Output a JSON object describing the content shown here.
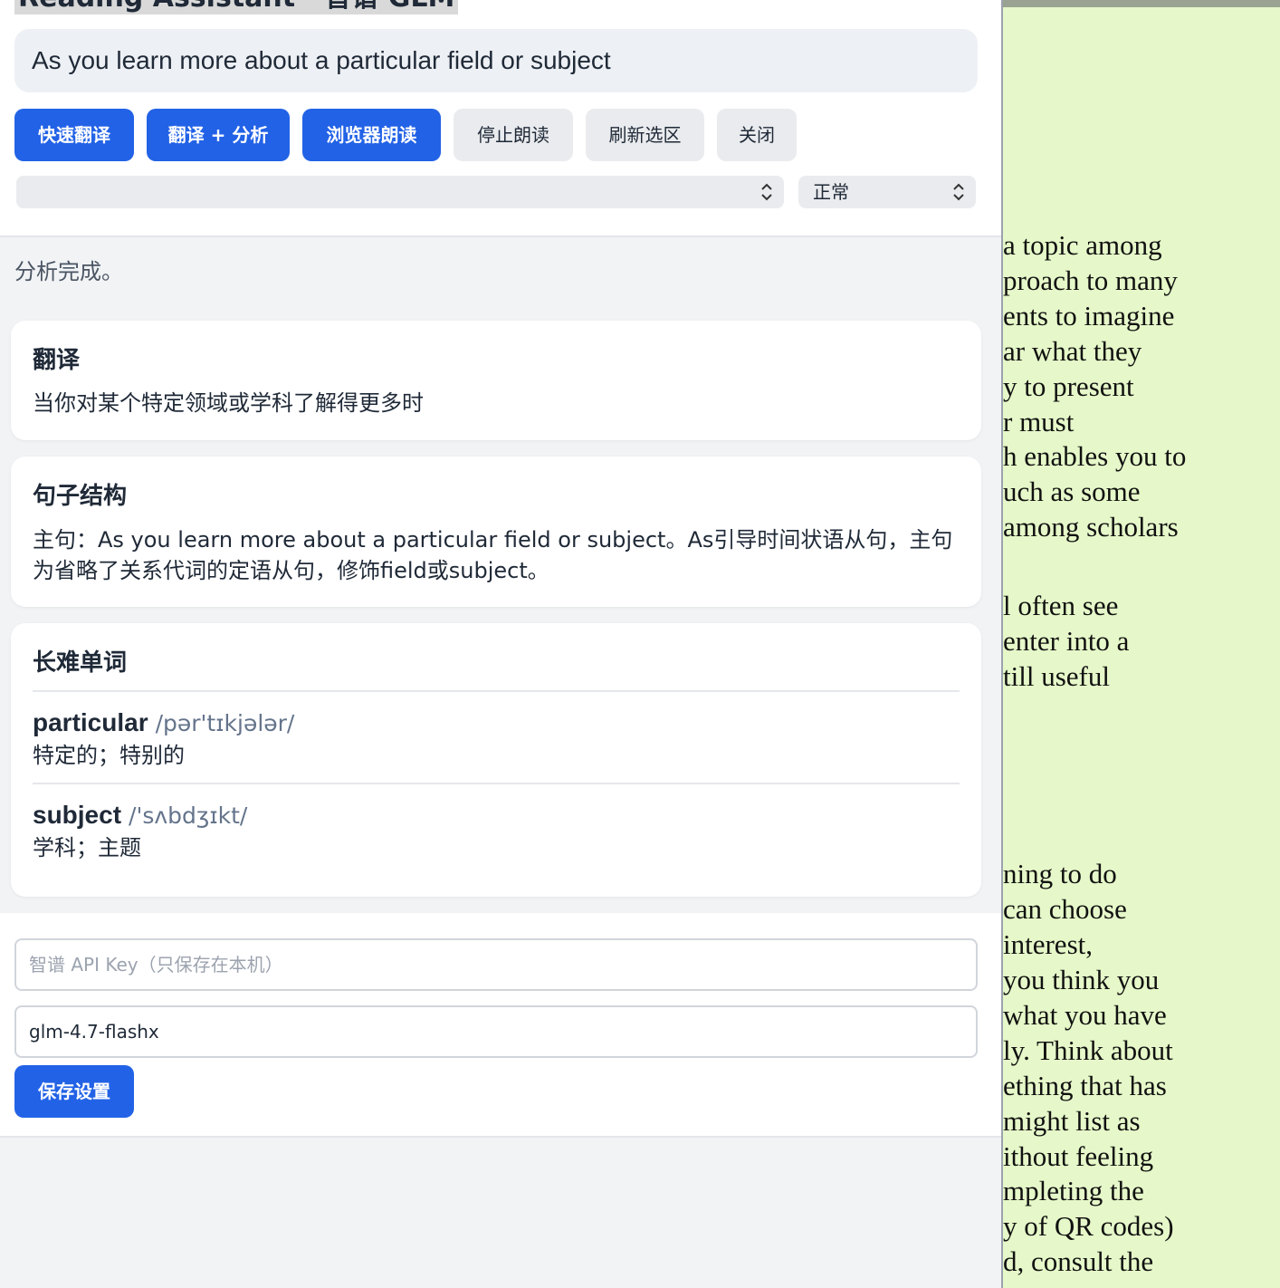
{
  "panel": {
    "title": "Reading Assistant · 智谱 GLM",
    "selection_text": "As you learn more about a particular field or subject",
    "buttons": {
      "quick_translate": "快速翻译",
      "translate_analyze": "翻译 + 分析",
      "browser_read": "浏览器朗读",
      "stop_read": "停止朗读",
      "refresh_selection": "刷新选区",
      "close": "关闭"
    },
    "voice_select_value": "",
    "speed_select_value": "正常",
    "status": "分析完成。",
    "translation": {
      "title": "翻译",
      "text": "当你对某个特定领域或学科了解得更多时"
    },
    "structure": {
      "title": "句子结构",
      "text": "主句：As you learn more about a particular field or subject。As引导时间状语从句，主句为省略了关系代词的定语从句，修饰field或subject。"
    },
    "vocabulary": {
      "title": "长难单词",
      "words": [
        {
          "word": "particular",
          "phonetic": "/pər'tɪkjələr/",
          "meaning": "特定的；特别的"
        },
        {
          "word": "subject",
          "phonetic": "/'sʌbdʒɪkt/",
          "meaning": "学科；主题"
        }
      ]
    },
    "settings": {
      "api_key_placeholder": "智谱 API Key（只保存在本机）",
      "api_key_value": "",
      "model_value": "glm-4.7-flashx",
      "save_label": "保存设置"
    }
  },
  "page_lines": [
    "a topic among",
    "proach to many",
    "ents to imagine",
    "ar what they",
    "y to present",
    "r must",
    "h enables you to",
    "uch as some",
    "among scholars",
    "l often see",
    "enter into a",
    "till useful",
    "ning to do",
    "can choose",
    " interest,",
    " you think you",
    " what you have",
    "ly. Think about",
    "ething that has",
    " might list as",
    "ithout feeling",
    "mpleting the",
    "y of QR codes)",
    "d, consult the"
  ],
  "colors": {
    "primary": "#2262e6",
    "page_background": "#e6f8c9"
  }
}
